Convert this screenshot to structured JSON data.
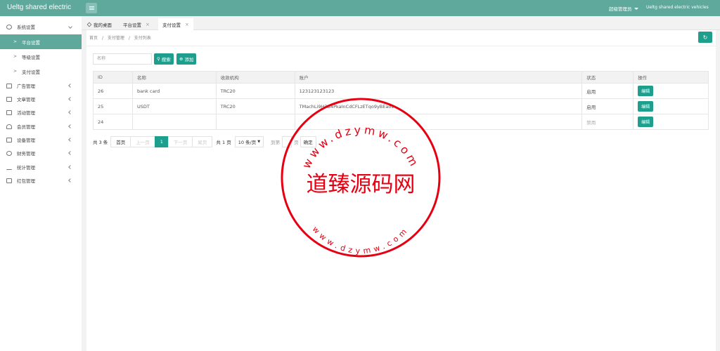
{
  "header": {
    "logo": "Ueltg shared electric",
    "admin": "超级管理员",
    "company": "Ueltg shared electric vehicles"
  },
  "sidebar": {
    "system": "系统设置",
    "subs": [
      "平台设置",
      "等级设置",
      "支付设置"
    ],
    "items": [
      "广告管理",
      "文章管理",
      "活动管理",
      "会员管理",
      "设备管理",
      "财务管理",
      "统计管理",
      "红包管理"
    ]
  },
  "tabs": [
    "我的桌面",
    "平台设置",
    "支付设置"
  ],
  "breadcrumb": [
    "首页",
    "/",
    "支付管理",
    "/",
    "支付列表"
  ],
  "search": {
    "placeholder": "名称",
    "search_label": "搜索",
    "add_label": "添加"
  },
  "table": {
    "headers": [
      "ID",
      "名称",
      "收款机构",
      "账户",
      "状态",
      "操作"
    ],
    "rows": [
      {
        "id": "26",
        "name": "bank card",
        "org": "TRC20",
        "account": "123123123123",
        "status": "启用",
        "action": "编辑"
      },
      {
        "id": "25",
        "name": "USDT",
        "org": "TRC20",
        "account": "TMachLi9H3B4PkaInCdCFLzETqo9yBEaos",
        "status": "启用",
        "action": "编辑"
      },
      {
        "id": "24",
        "name": "",
        "org": "",
        "account": "",
        "status": "禁用",
        "action": "编辑"
      }
    ]
  },
  "pager": {
    "count": "共 3 条",
    "first": "首页",
    "prev": "上一页",
    "current": "1",
    "next": "下一页",
    "last": "尾页",
    "pages": "共 1 页",
    "size": "10 条/页",
    "goto": "到第",
    "page_unit": "页",
    "confirm": "确定"
  },
  "watermark": {
    "center": "道臻源码网",
    "ring": "www.dzymw.com"
  },
  "colors": {
    "brand": "#5fa89c",
    "button": "#1e9e8c",
    "stamp": "#e60012"
  }
}
